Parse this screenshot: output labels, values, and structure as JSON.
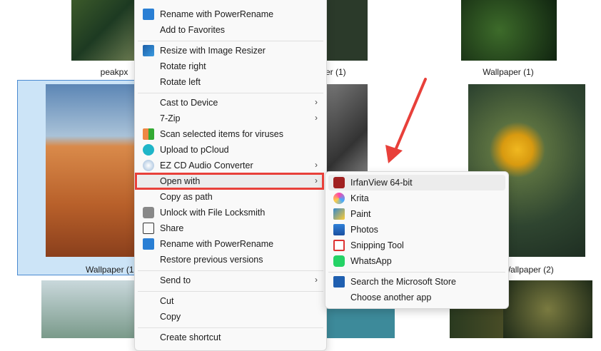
{
  "tiles": [
    {
      "label": "peakpx"
    },
    {
      "label": "er (1)"
    },
    {
      "label": "Wallpaper (1)"
    },
    {
      "label": "Wallpaper (1"
    },
    {
      "label": "Wallpaper (2)"
    }
  ],
  "context_menu": {
    "items": [
      {
        "label": "Rename with PowerRename",
        "icon": "powerrename-icon"
      },
      {
        "label": "Add to Favorites"
      },
      {
        "label": "Resize with Image Resizer",
        "icon": "image-resizer-icon"
      },
      {
        "label": "Rotate right"
      },
      {
        "label": "Rotate left"
      },
      {
        "label": "Cast to Device",
        "submenu": true
      },
      {
        "label": "7-Zip",
        "submenu": true
      },
      {
        "label": "Scan selected items for viruses",
        "icon": "avg-icon"
      },
      {
        "label": "Upload to pCloud",
        "icon": "pcloud-icon"
      },
      {
        "label": "EZ CD Audio Converter",
        "icon": "cd-icon",
        "submenu": true
      },
      {
        "label": "Open with",
        "submenu": true,
        "highlighted": true
      },
      {
        "label": "Copy as path"
      },
      {
        "label": "Unlock with File Locksmith",
        "icon": "lock-icon"
      },
      {
        "label": "Share",
        "icon": "share-icon"
      },
      {
        "label": "Rename with PowerRename",
        "icon": "powerrename-icon"
      },
      {
        "label": "Restore previous versions"
      },
      {
        "label": "Send to",
        "submenu": true
      },
      {
        "label": "Cut"
      },
      {
        "label": "Copy"
      },
      {
        "label": "Create shortcut"
      }
    ],
    "chevron": "›"
  },
  "open_with_menu": {
    "items": [
      {
        "label": "IrfanView 64-bit",
        "icon": "irfanview-icon"
      },
      {
        "label": "Krita",
        "icon": "krita-icon"
      },
      {
        "label": "Paint",
        "icon": "paint-icon"
      },
      {
        "label": "Photos",
        "icon": "photos-icon"
      },
      {
        "label": "Snipping Tool",
        "icon": "snipping-tool-icon"
      },
      {
        "label": "WhatsApp",
        "icon": "whatsapp-icon"
      },
      {
        "label": "Search the Microsoft Store",
        "icon": "store-icon"
      },
      {
        "label": "Choose another app"
      }
    ]
  },
  "annotation_color": "#e8403a"
}
